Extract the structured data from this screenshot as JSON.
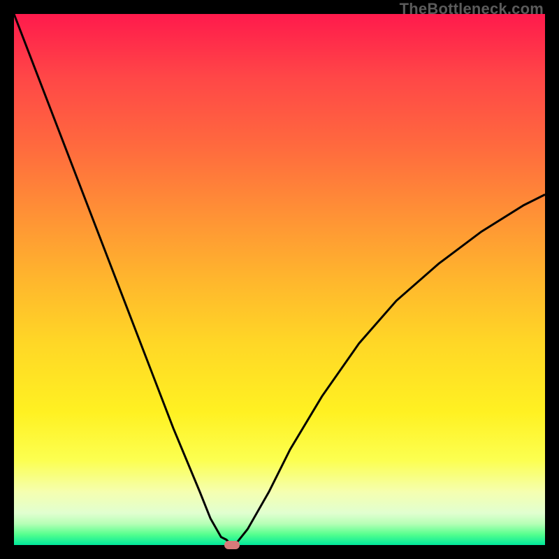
{
  "watermark": "TheBottleneck.com",
  "chart_data": {
    "type": "line",
    "title": "",
    "xlabel": "",
    "ylabel": "",
    "xlim": [
      0,
      100
    ],
    "ylim": [
      0,
      100
    ],
    "grid": false,
    "legend": false,
    "series": [
      {
        "name": "bottleneck-curve",
        "x": [
          0,
          5,
          10,
          15,
          20,
          25,
          30,
          35,
          37,
          39,
          40,
          41,
          42,
          44,
          48,
          52,
          58,
          65,
          72,
          80,
          88,
          96,
          100
        ],
        "values": [
          100,
          87,
          74,
          61,
          48,
          35,
          22,
          10,
          5,
          1.5,
          1,
          0,
          0.5,
          3,
          10,
          18,
          28,
          38,
          46,
          53,
          59,
          64,
          66
        ]
      }
    ],
    "marker": {
      "x": 41,
      "y": 0,
      "shape": "pill",
      "color": "#d87a7a"
    },
    "background_gradient": {
      "type": "vertical",
      "stops": [
        {
          "pos": 0,
          "color": "#ff1a4c"
        },
        {
          "pos": 25,
          "color": "#ff6a3e"
        },
        {
          "pos": 50,
          "color": "#ffb62d"
        },
        {
          "pos": 75,
          "color": "#fff122"
        },
        {
          "pos": 90,
          "color": "#f5ffb0"
        },
        {
          "pos": 100,
          "color": "#00e89a"
        }
      ]
    }
  }
}
